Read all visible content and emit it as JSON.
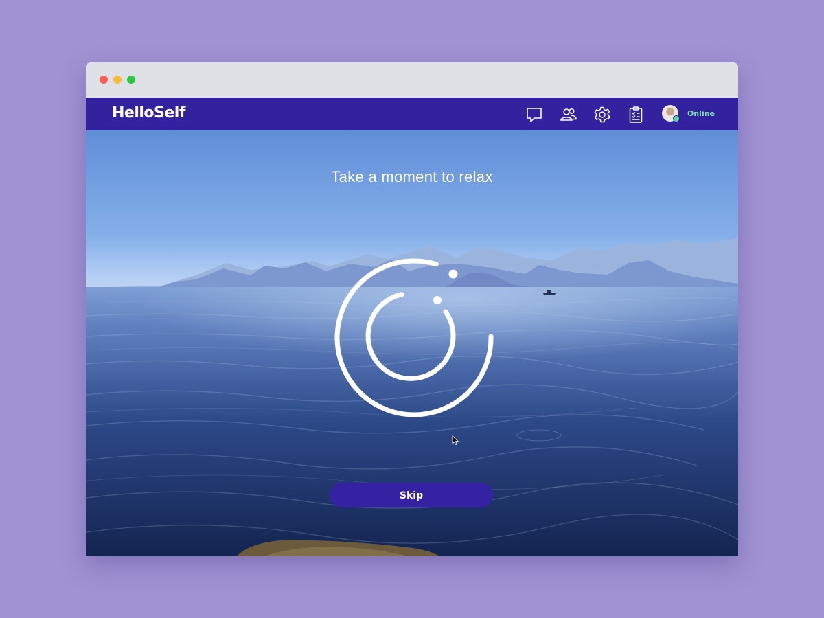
{
  "app": {
    "name": "HelloSelf"
  },
  "nav": {
    "icons": [
      "chat-icon",
      "people-icon",
      "settings-icon",
      "checklist-icon"
    ],
    "status": "Online"
  },
  "main": {
    "headline": "Take a moment to relax",
    "skip_label": "Skip"
  },
  "colors": {
    "page_background": "#a093d3",
    "brand": "#33229f",
    "button": "#3522a3",
    "online": "#7ce0b4",
    "window_close": "#fd5d55",
    "window_minimize": "#fcbb2e",
    "window_maximize": "#2bc840"
  }
}
